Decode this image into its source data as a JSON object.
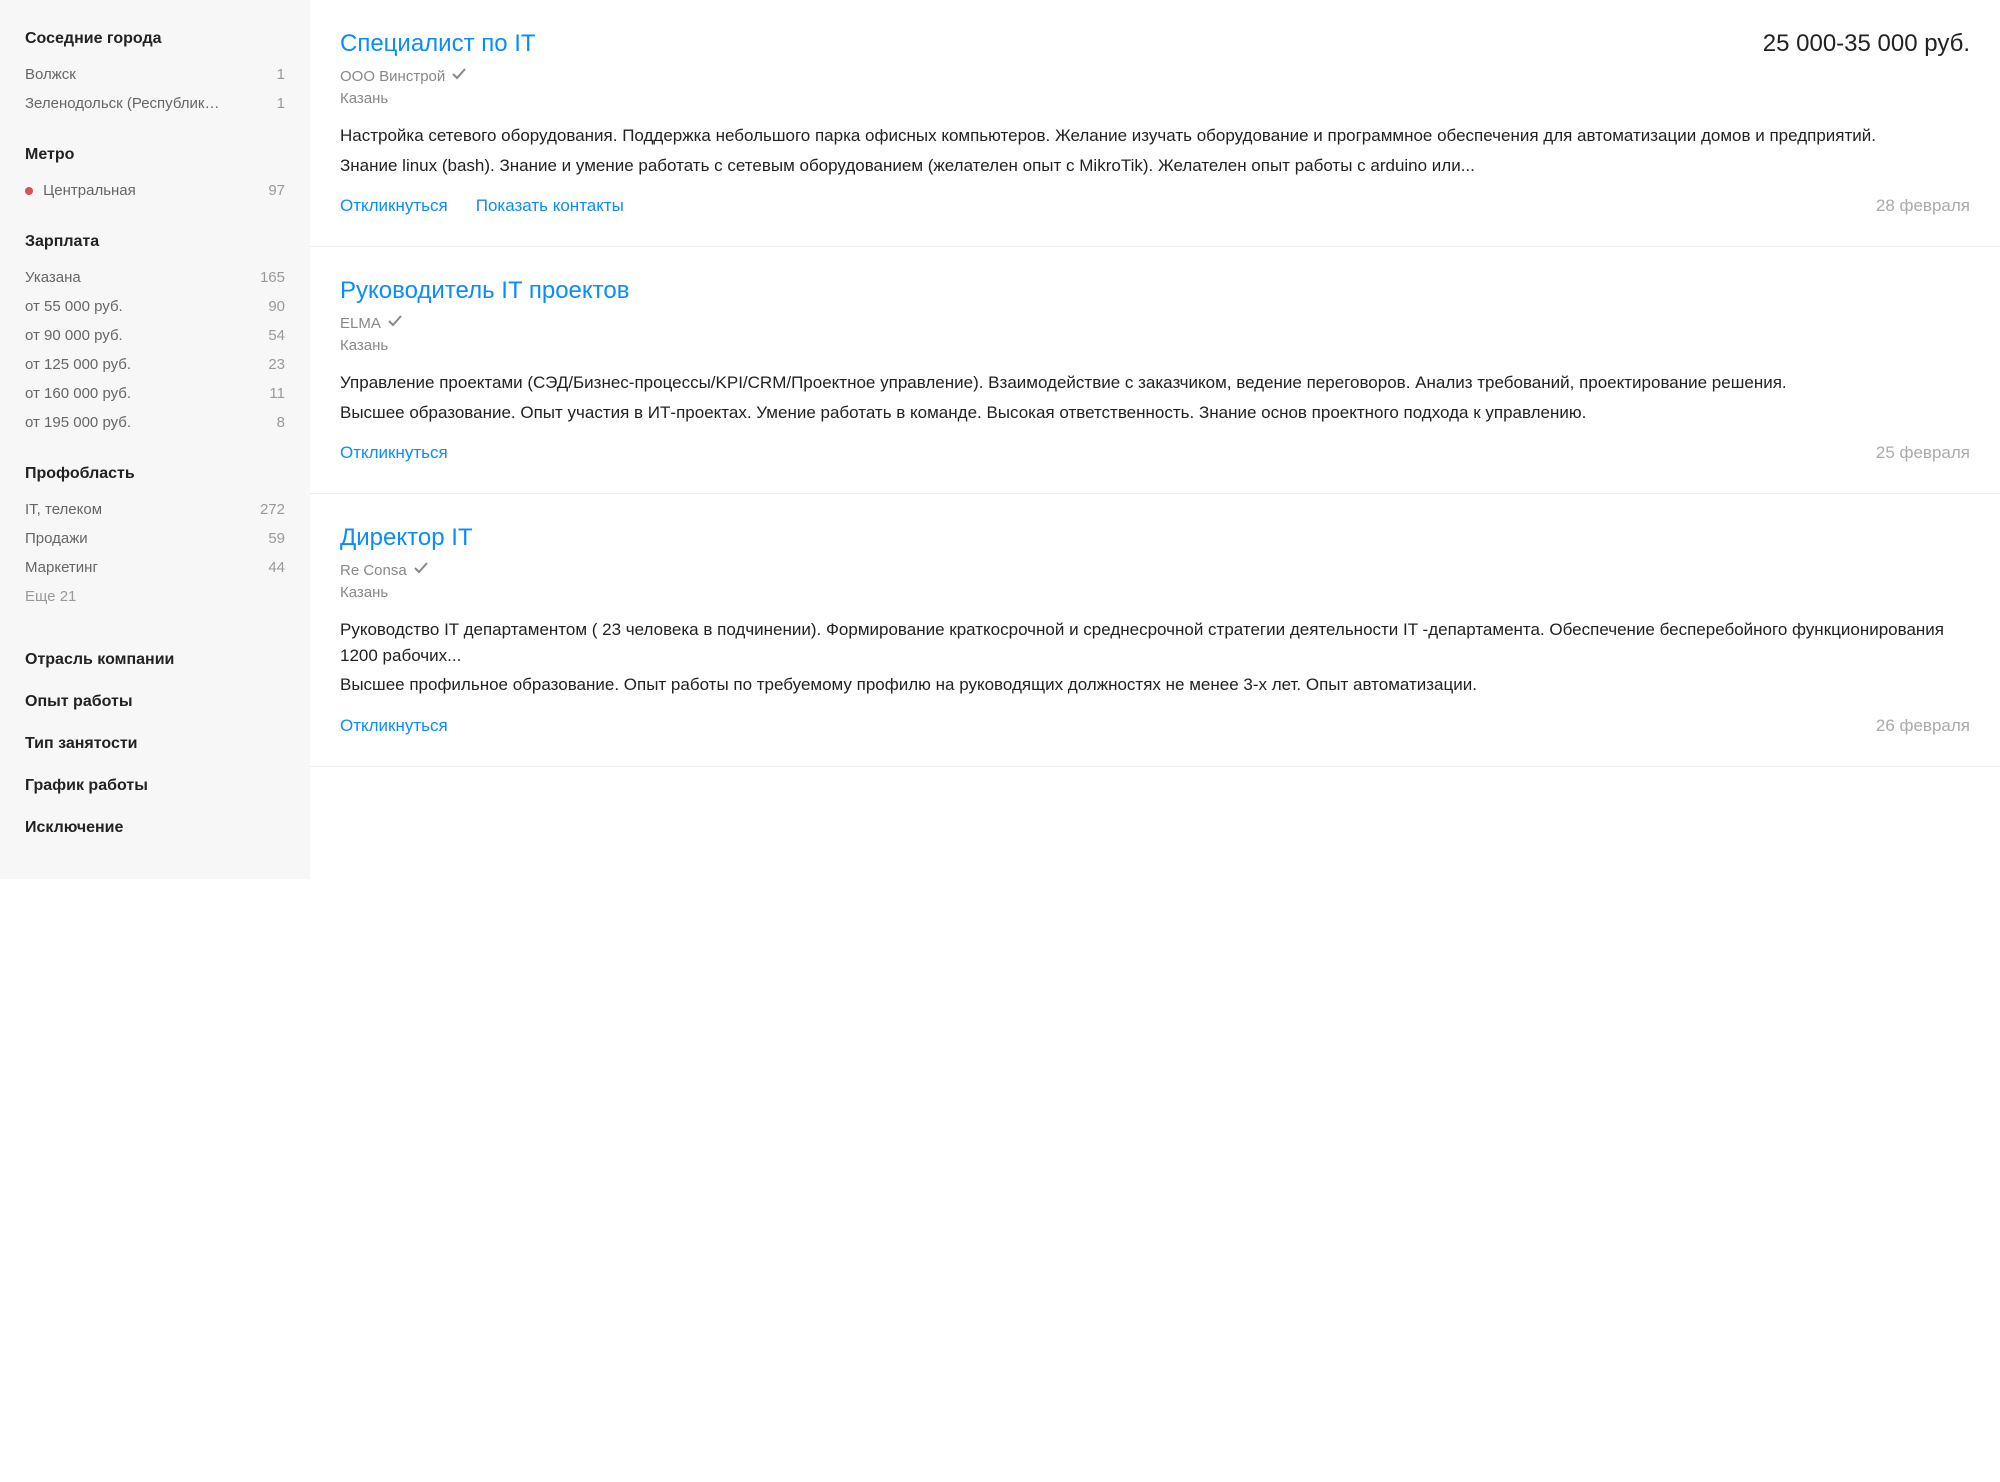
{
  "sidebar": {
    "cities": {
      "title": "Соседние города",
      "items": [
        {
          "label": "Волжск",
          "count": "1"
        },
        {
          "label": "Зеленодольск (Республик…",
          "count": "1"
        }
      ]
    },
    "metro": {
      "title": "Метро",
      "items": [
        {
          "label": "Центральная",
          "count": "97"
        }
      ]
    },
    "salary": {
      "title": "Зарплата",
      "items": [
        {
          "label": "Указана",
          "count": "165"
        },
        {
          "label": "от 55 000 руб.",
          "count": "90"
        },
        {
          "label": "от 90 000 руб.",
          "count": "54"
        },
        {
          "label": "от 125 000 руб.",
          "count": "23"
        },
        {
          "label": "от 160 000 руб.",
          "count": "11"
        },
        {
          "label": "от 195 000 руб.",
          "count": "8"
        }
      ]
    },
    "profarea": {
      "title": "Профобласть",
      "items": [
        {
          "label": "IT, телеком",
          "count": "272"
        },
        {
          "label": "Продажи",
          "count": "59"
        },
        {
          "label": "Маркетинг",
          "count": "44"
        }
      ],
      "more": "Еще 21"
    },
    "collapsed": [
      "Отрасль компании",
      "Опыт работы",
      "Тип занятости",
      "График работы",
      "Исключение"
    ]
  },
  "vacancies": [
    {
      "title": "Специалист по IT",
      "salary": "25 000-35 000 руб.",
      "company": "ООО Винстрой",
      "location": "Казань",
      "desc1": "Настройка сетевого оборудования. Поддержка небольшого парка офисных компьютеров. Желание изучать оборудование и программное обеспечения для автоматизации домов и предприятий.",
      "desc2": "Знание linux (bash). Знание и умение работать с сетевым оборудованием (желателен опыт с MikroTik). Желателен опыт работы с arduino или...",
      "apply": "Откликнуться",
      "contacts": "Показать контакты",
      "date": "28 февраля"
    },
    {
      "title": "Руководитель IT проектов",
      "salary": "",
      "company": "ELMA",
      "location": "Казань",
      "desc1": "Управление проектами (СЭД/Бизнес-процессы/KPI/CRM/Проектное управление). Взаимодействие с заказчиком, ведение переговоров. Анализ требований, проектирование решения.",
      "desc2": "Высшее образование. Опыт участия в ИТ-проектах. Умение работать в команде. Высокая ответственность. Знание основ проектного подхода к управлению.",
      "apply": "Откликнуться",
      "contacts": "",
      "date": "25 февраля"
    },
    {
      "title": "Директор IT",
      "salary": "",
      "company": "Re Consa",
      "location": "Казань",
      "desc1": "Руководство IT департаментом ( 23 человека в подчинении). Формирование краткосрочной и среднесрочной стратегии деятельности IT -департамента. Обеспечение бесперебойного функционирования 1200 рабочих...",
      "desc2": "Высшее профильное образование. Опыт работы по требуемому профилю на руководящих должностях не менее 3-х лет. Опыт автоматизации.",
      "apply": "Откликнуться",
      "contacts": "",
      "date": "26 февраля"
    }
  ]
}
